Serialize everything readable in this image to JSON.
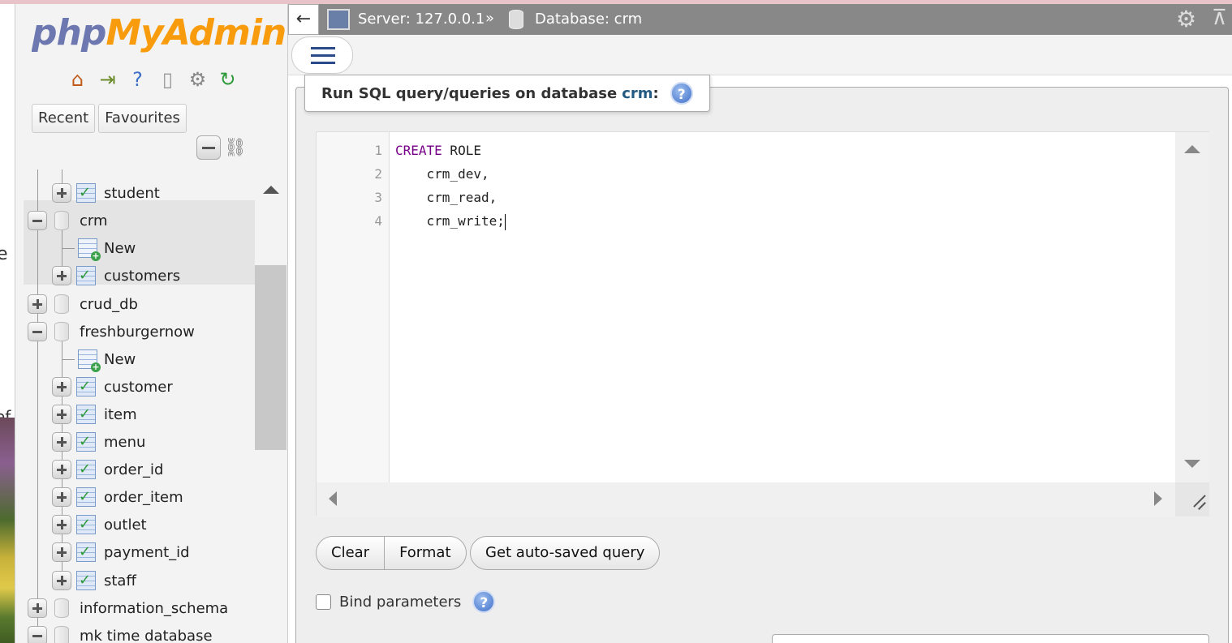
{
  "background": {
    "fragment_1": "e",
    "fragment_2": "ef"
  },
  "logo": {
    "part1": "php",
    "part2": "MyAdmin"
  },
  "nav": {
    "icons": [
      "home-icon",
      "exit-icon",
      "help-icon",
      "documentation-icon",
      "settings-icon",
      "reload-icon"
    ],
    "tabs": {
      "recent": "Recent",
      "favourites": "Favourites"
    },
    "tree": [
      {
        "label": "student",
        "type": "table",
        "expanded": false
      },
      {
        "label": "crm",
        "type": "database",
        "expanded": true
      },
      {
        "label": "New",
        "type": "new"
      },
      {
        "label": "customers",
        "type": "table",
        "expanded": false
      },
      {
        "label": "crud_db",
        "type": "database",
        "expanded": false
      },
      {
        "label": "freshburgernow",
        "type": "database",
        "expanded": true
      },
      {
        "label": "New",
        "type": "new"
      },
      {
        "label": "customer",
        "type": "table"
      },
      {
        "label": "item",
        "type": "table"
      },
      {
        "label": "menu",
        "type": "table"
      },
      {
        "label": "order_id",
        "type": "table"
      },
      {
        "label": "order_item",
        "type": "table"
      },
      {
        "label": "outlet",
        "type": "table"
      },
      {
        "label": "payment_id",
        "type": "table"
      },
      {
        "label": "staff",
        "type": "table"
      },
      {
        "label": "information_schema",
        "type": "database",
        "expanded": false
      },
      {
        "label": "mk time database",
        "type": "database",
        "expanded": true
      }
    ]
  },
  "topbar": {
    "back": "←",
    "server": "Server: 127.0.0.1",
    "separator": "»",
    "database": "Database: crm"
  },
  "query": {
    "legend_prefix": "Run SQL query/queries on database",
    "db": "crm",
    "legend_suffix": ":",
    "help_glyph": "?",
    "lines": [
      {
        "num": "1",
        "keyword": "CREATE",
        "text": " ROLE"
      },
      {
        "num": "2",
        "keyword": "",
        "text": "    crm_dev,"
      },
      {
        "num": "3",
        "keyword": "",
        "text": "    crm_read,"
      },
      {
        "num": "4",
        "keyword": "",
        "text": "    crm_write;"
      }
    ]
  },
  "buttons": {
    "clear": "Clear",
    "format": "Format",
    "autosaved": "Get auto-saved query"
  },
  "bind": {
    "label": "Bind parameters",
    "checked": false
  },
  "colors": {
    "logo_php": "#6c78af",
    "logo_myadmin": "#f89c0e",
    "topbar_bg": "#888888",
    "keyword": "#770088",
    "db_link": "#235a81"
  }
}
